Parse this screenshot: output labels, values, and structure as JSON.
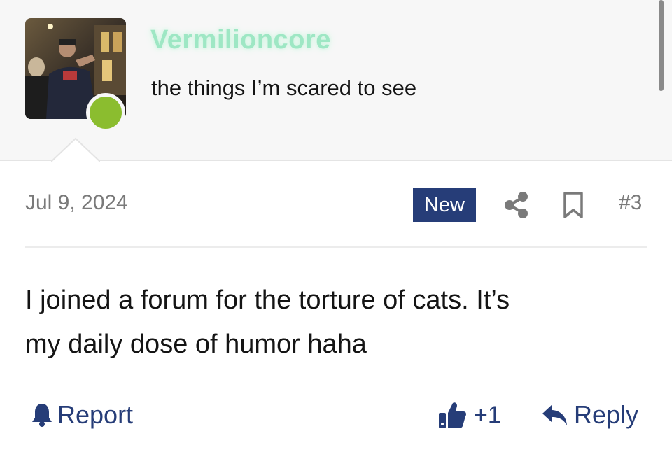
{
  "author": {
    "username": "Vermilioncore",
    "title": "the things I’m scared to see",
    "online_color": "#8bbd2f",
    "username_color": "#9ee7c4"
  },
  "post": {
    "date": "Jul 9, 2024",
    "badge": "New",
    "number": "#3",
    "body_line1": "I joined a forum for the torture of cats. It’s",
    "body_line2": "my daily dose of humor haha"
  },
  "actions": {
    "report_label": "Report",
    "like_label": "+1",
    "reply_label": "Reply"
  },
  "icons": [
    "bell-icon",
    "share-icon",
    "bookmark-icon",
    "thumbs-up-icon",
    "reply-arrow-icon"
  ],
  "colors": {
    "accent": "#263d78",
    "muted_text": "#7a7a7a"
  }
}
